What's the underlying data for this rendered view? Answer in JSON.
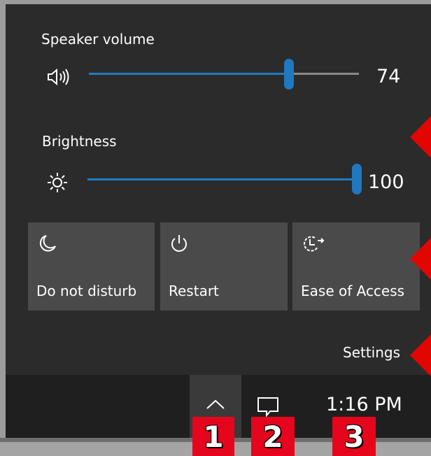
{
  "volume": {
    "label": "Speaker volume",
    "value": "74",
    "level": 74,
    "icon": "speaker-icon"
  },
  "brightness": {
    "label": "Brightness",
    "value": "100",
    "level": 100,
    "icon": "sun-icon"
  },
  "tiles": [
    {
      "label": "Do not disturb",
      "icon": "moon-icon"
    },
    {
      "label": "Restart",
      "icon": "power-icon"
    },
    {
      "label": "Ease of Access",
      "icon": "ease-of-access-icon"
    }
  ],
  "settings_link": "Settings",
  "taskbar": {
    "tray_chevron_icon": "chevron-up-icon",
    "action_center_icon": "action-center-icon",
    "time": "1:16 PM"
  },
  "markers": [
    "1",
    "2",
    "3"
  ],
  "colors": {
    "accent": "#1f78c0",
    "panel": "#2b2b2b",
    "tile": "#4a4a4a",
    "taskbar": "#1f1f1f",
    "marker": "#e5051c"
  }
}
